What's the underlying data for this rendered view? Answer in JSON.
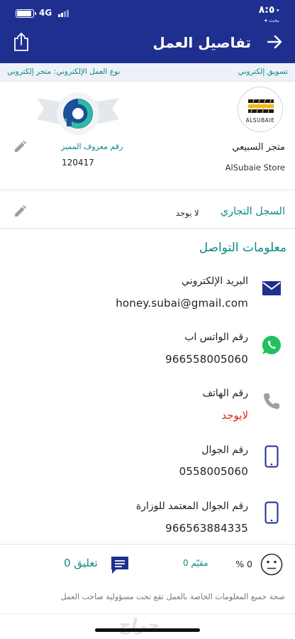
{
  "status_bar": {
    "time": "٨:٥٠",
    "back_app": "◂ بحث",
    "network": "4G",
    "battery_level": 0.85
  },
  "header": {
    "title": "تفاصيل العمل"
  },
  "category_bar": {
    "category": "تسويق إلكتروني",
    "business_type": "نوع العمل الإلكتروني: متجر إلكتروني"
  },
  "profile": {
    "logo_text": "ALSUBAIE",
    "store_name": "متجر السبيعي",
    "store_name_en": "AlSubaie Store",
    "maroof_label": "رقم معروف المميز",
    "maroof_number": "120417"
  },
  "commercial_register": {
    "label": "السجل التجاري",
    "value": "لا يوجد"
  },
  "contact": {
    "title": "معلومات التواصل",
    "items": [
      {
        "label": "البريد الإلكتروني",
        "value": "honey.subai@gmail.com",
        "icon": "mail-icon"
      },
      {
        "label": "رقم الواتس اب",
        "value": "966558005060",
        "icon": "whatsapp-icon"
      },
      {
        "label": "رقم الهاتف",
        "value": "لايوجد",
        "icon": "phone-icon"
      },
      {
        "label": "رقم الجوال",
        "value": "0558005060",
        "icon": "mobile-icon"
      },
      {
        "label": "رقم الجوال المعتمد للوزارة",
        "value": "966563884335",
        "icon": "mobile-icon"
      }
    ]
  },
  "stats": {
    "rating_percent": "% 0",
    "rated_count": "0 مقيّم",
    "comments": "0 تعليق"
  },
  "disclaimer": "صحة جميع المعلومات الخاصة بالعمل تقع تحت مسؤولية صاحب العمل",
  "watermark": "حراج",
  "colors": {
    "primary": "#1f2f8f",
    "accent": "#0b8a85",
    "danger": "#e0221b"
  }
}
